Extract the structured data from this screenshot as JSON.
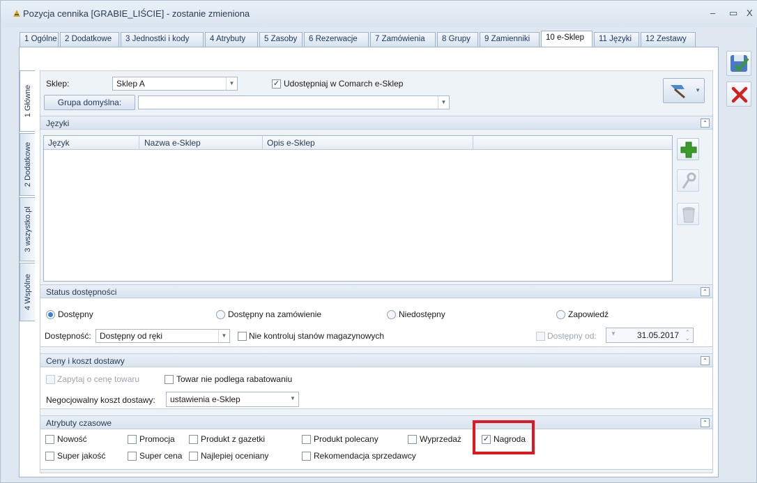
{
  "window": {
    "title": "Pozycja cennika [GRABIE_LIŚCIE] - zostanie zmieniona",
    "min": "–",
    "max": "▭",
    "close": "X"
  },
  "tabs": [
    {
      "label": "1 Ogólne"
    },
    {
      "label": "2 Dodatkowe"
    },
    {
      "label": "3 Jednostki i kody"
    },
    {
      "label": "4 Atrybuty"
    },
    {
      "label": "5 Zasoby"
    },
    {
      "label": "6 Rezerwacje"
    },
    {
      "label": "7 Zamówienia"
    },
    {
      "label": "8 Grupy"
    },
    {
      "label": "9 Zamienniki"
    },
    {
      "label": "10 e-Sklep"
    },
    {
      "label": "11 Języki"
    },
    {
      "label": "12 Zestawy"
    }
  ],
  "vertical_tabs": [
    {
      "label": "1 Główne"
    },
    {
      "label": "2 Dodatkowe"
    },
    {
      "label": "3 wszystko.pl"
    },
    {
      "label": "4 Wspólne"
    }
  ],
  "shop": {
    "label": "Sklep:",
    "value": "Sklep A",
    "share_label": "Udostępniaj w Comarch e-Sklep",
    "share_checked": "✓",
    "default_group_button": "Grupa domyślna:",
    "default_group_value": ""
  },
  "languages": {
    "title": "Języki",
    "columns": [
      "Język",
      "Nazwa e-Sklep",
      "Opis e-Sklep"
    ],
    "collapse": "⌃"
  },
  "availability": {
    "title": "Status dostępności",
    "radios": [
      "Dostępny",
      "Dostępny na zamówienie",
      "Niedostępny",
      "Zapowiedź"
    ],
    "selected": "Dostępny",
    "availability_label": "Dostępność:",
    "availability_value": "Dostępny od ręki",
    "no_stock_control": "Nie kontroluj stanów magazynowych",
    "available_from_label": "Dostępny od:",
    "available_from_date": "31.05.2017"
  },
  "prices": {
    "title": "Ceny i koszt dostawy",
    "ask_price": "Zapytaj o cenę towaru",
    "no_discount": "Towar nie podlega rabatowaniu",
    "negotiable_label": "Negocjowalny koszt dostawy:",
    "negotiable_value": "ustawienia e-Sklep"
  },
  "attributes": {
    "title": "Atrybuty czasowe",
    "row1": [
      "Nowość",
      "Promocja",
      "Produkt z gazetki",
      "Produkt polecany",
      "Wyprzedaż",
      "Nagroda"
    ],
    "row2": [
      "Super jakość",
      "Super cena",
      "Najlepiej oceniany",
      "Rekomendacja sprzedawcy"
    ],
    "checked": "✓"
  },
  "colors": {
    "accent": "#3b7fd6",
    "highlight": "#e3151f",
    "save_green": "#3a9a2c",
    "cancel_red": "#d42020"
  }
}
